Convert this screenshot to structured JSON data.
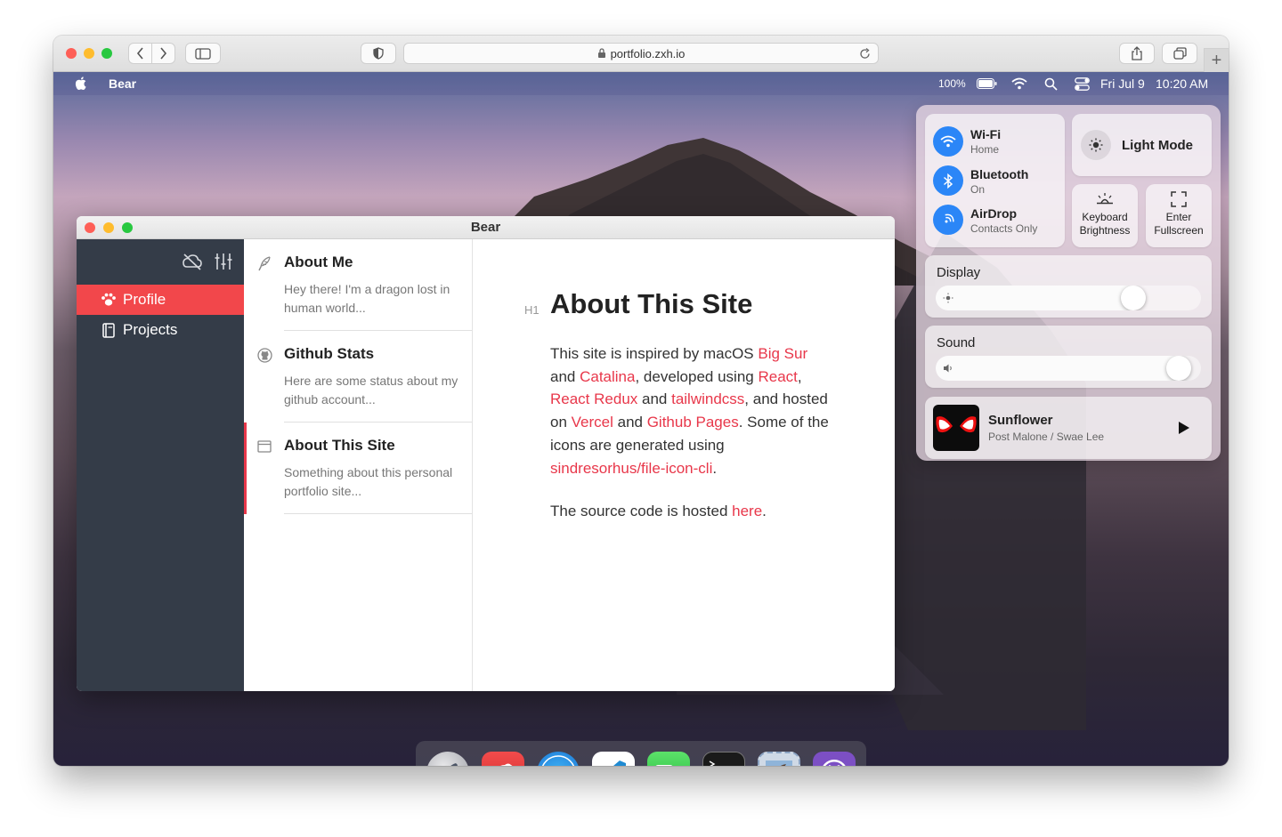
{
  "browser": {
    "url": "portfolio.zxh.io",
    "new_tab": "+"
  },
  "menubar": {
    "app_name": "Bear",
    "battery": "100%",
    "date": "Fri Jul 9",
    "time": "10:20 AM"
  },
  "bear": {
    "window_title": "Bear",
    "sidebar": {
      "items": [
        {
          "label": "Profile",
          "selected": true
        },
        {
          "label": "Projects",
          "selected": false
        }
      ]
    },
    "notes": [
      {
        "title": "About Me",
        "snippet": "Hey there! I'm a dragon lost in human world..."
      },
      {
        "title": "Github Stats",
        "snippet": "Here are some status about my github account..."
      },
      {
        "title": "About This Site",
        "snippet": "Something about this personal portfolio site...",
        "selected": true
      }
    ],
    "editor": {
      "heading_tag": "H1",
      "heading": "About This Site",
      "p1": {
        "t1": "This site is inspired by macOS ",
        "l1": "Big Sur",
        "t2": " and ",
        "l2": "Catalina",
        "t3": ", developed using ",
        "l3": "React",
        "t4": ", ",
        "l4": "React Redux",
        "t5": " and ",
        "l5": "tailwindcss",
        "t6": ", and hosted on ",
        "l6": "Vercel",
        "t7": " and ",
        "l7": "Github Pages",
        "t8": ". Some of the icons are generated using ",
        "l8": "sindresorhus/file-icon-cli",
        "t9": "."
      },
      "p2": {
        "t1": "The source code is hosted ",
        "l1": "here",
        "t2": "."
      }
    }
  },
  "control_center": {
    "wifi": {
      "label": "Wi-Fi",
      "sub": "Home"
    },
    "bluetooth": {
      "label": "Bluetooth",
      "sub": "On"
    },
    "airdrop": {
      "label": "AirDrop",
      "sub": "Contacts Only"
    },
    "light_mode": "Light Mode",
    "keyboard_brightness": {
      "l1": "Keyboard",
      "l2": "Brightness"
    },
    "fullscreen": {
      "l1": "Enter",
      "l2": "Fullscreen"
    },
    "display": {
      "label": "Display",
      "level": 0.77
    },
    "sound": {
      "label": "Sound",
      "level": 0.96
    },
    "music": {
      "title": "Sunflower",
      "artist": "Post Malone / Swae Lee"
    }
  },
  "dock": {
    "apps": [
      "launchpad-icon",
      "bear-app-icon",
      "safari-icon",
      "vscode-icon",
      "facetime-icon",
      "terminal-icon",
      "mail-icon",
      "github-icon"
    ]
  },
  "colors": {
    "accent": "#e8374a",
    "sidebar_bg": "#343c48",
    "selected_sidebar": "#f2474b",
    "blue": "#2b86f7"
  }
}
